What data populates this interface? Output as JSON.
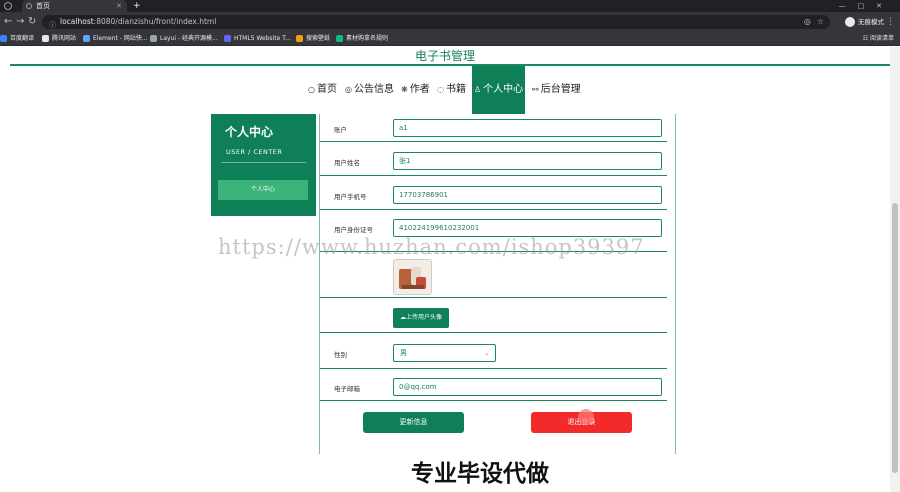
{
  "browser": {
    "tab_title": "首页",
    "new_tab": "+",
    "url_host": "localhost",
    "url_rest": ":8080/dianzishu/front/index.html",
    "profile_label": "无痕模式",
    "bookmarks": [
      "百度翻译",
      "腾讯网站",
      "Element - 网站快...",
      "Layui - 经典开源模...",
      "HTML5 Website T...",
      "搜索壁纸",
      "素材购拿名规则"
    ],
    "reading_list": "阅读清单"
  },
  "site": {
    "title": "电子书管理"
  },
  "nav": [
    {
      "icon": "○",
      "label": "首页"
    },
    {
      "icon": "◎",
      "label": "公告信息"
    },
    {
      "icon": "❋",
      "label": "作者"
    },
    {
      "icon": "◌",
      "label": "书籍"
    },
    {
      "icon": "♙",
      "label": "个人中心"
    },
    {
      "icon": "⚯",
      "label": "后台管理"
    }
  ],
  "sidebar": {
    "title": "个人中心",
    "subtitle": "USER / CENTER",
    "button": "个人中心"
  },
  "form": {
    "account_label": "账户",
    "account_value": "a1",
    "name_label": "用户姓名",
    "name_value": "张1",
    "phone_label": "用户手机号",
    "phone_value": "17703786901",
    "idcard_label": "用户身份证号",
    "idcard_value": "410224199610232001",
    "upload_label": "上传用户头像",
    "gender_label": "性别",
    "gender_value": "男",
    "email_label": "电子邮箱",
    "email_value": "0@qq.com",
    "update_button": "更新信息",
    "logout_button": "退出登录"
  },
  "overlay": {
    "watermark": "https://www.huzhan.com/ishop39397",
    "caption": "专业毕设代做"
  },
  "colors": {
    "brand": "#0f7f58",
    "danger": "#f32a2a"
  }
}
